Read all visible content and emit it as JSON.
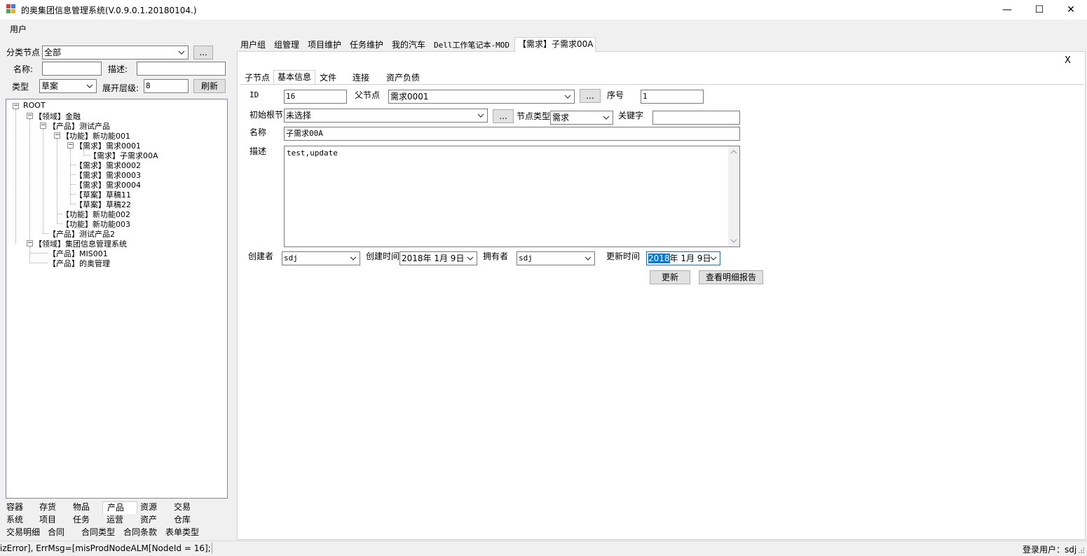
{
  "window": {
    "title": "的奥集团信息管理系统(V.0.9.0.1.20180104.)",
    "minimize": "—",
    "maximize": "☐",
    "close": "✕"
  },
  "menu": {
    "user": "用户"
  },
  "filter": {
    "category_label": "分类节点",
    "category_value": "全部",
    "browse": "...",
    "name_label": "名称:",
    "name_value": "",
    "desc_label": "描述:",
    "desc_value": "",
    "type_label": "类型",
    "type_value": "草案",
    "level_label": "展开层级:",
    "level_value": "8",
    "refresh": "刷新"
  },
  "tree": {
    "root": "ROOT",
    "n1": "【领域】金融",
    "n2": "【产品】测试产品",
    "n3": "【功能】新功能001",
    "n4": "【需求】需求0001",
    "n5": "【需求】子需求00A",
    "n6": "【需求】需求0002",
    "n7": "【需求】需求0003",
    "n8": "【需求】需求0004",
    "n9": "【草案】草稿11",
    "n10": "【草案】草稿22",
    "n11": "【功能】新功能002",
    "n12": "【功能】新功能003",
    "n13": "【产品】测试产品2",
    "n14": "【领域】集团信息管理系统",
    "n15": "【产品】MIS001",
    "n16": "【产品】的奥管理"
  },
  "bottom_tabs": {
    "r1": [
      "容器",
      "存货",
      "物品",
      "产品",
      "资源",
      "交易"
    ],
    "r2": [
      "系统",
      "项目",
      "任务",
      "运营",
      "资产",
      "仓库"
    ],
    "r3": [
      "交易明细",
      "合同",
      "合同类型",
      "合同条款",
      "表单类型"
    ]
  },
  "top_tabs": [
    "用户组",
    "组管理",
    "项目维护",
    "任务维护",
    "我的汽车",
    "Dell工作笔记本-MOD",
    "【需求】子需求00A"
  ],
  "close_x": "X",
  "sub_tabs": [
    "子节点",
    "基本信息",
    "文件",
    "连接",
    "资产负债"
  ],
  "form": {
    "id_label": "ID",
    "id_value": "16",
    "parent_label": "父节点",
    "parent_value": "需求0001",
    "browse": "...",
    "seq_label": "序号",
    "seq_value": "1",
    "root_label": "初始根节",
    "root_value": "未选择",
    "node_type_label": "节点类型",
    "node_type_value": "需求",
    "keyword_label": "关键字",
    "keyword_value": "",
    "name_label": "名称",
    "name_value": "子需求00A",
    "desc_label": "描述",
    "desc_value": "test,update",
    "creator_label": "创建者",
    "creator_value": "sdj",
    "created_label": "创建时间",
    "created_value": "2018年 1月 9日",
    "owner_label": "拥有者",
    "owner_value": "sdj",
    "updated_label": "更新时间",
    "updated_year": "2018",
    "updated_rest": "年 1月 9日",
    "update_btn": "更新",
    "report_btn": "查看明细报告"
  },
  "status": {
    "message": "izError], ErrMsg=[misProdNodeALM[NodeId = 16];",
    "login": "登录用户：sdj"
  }
}
